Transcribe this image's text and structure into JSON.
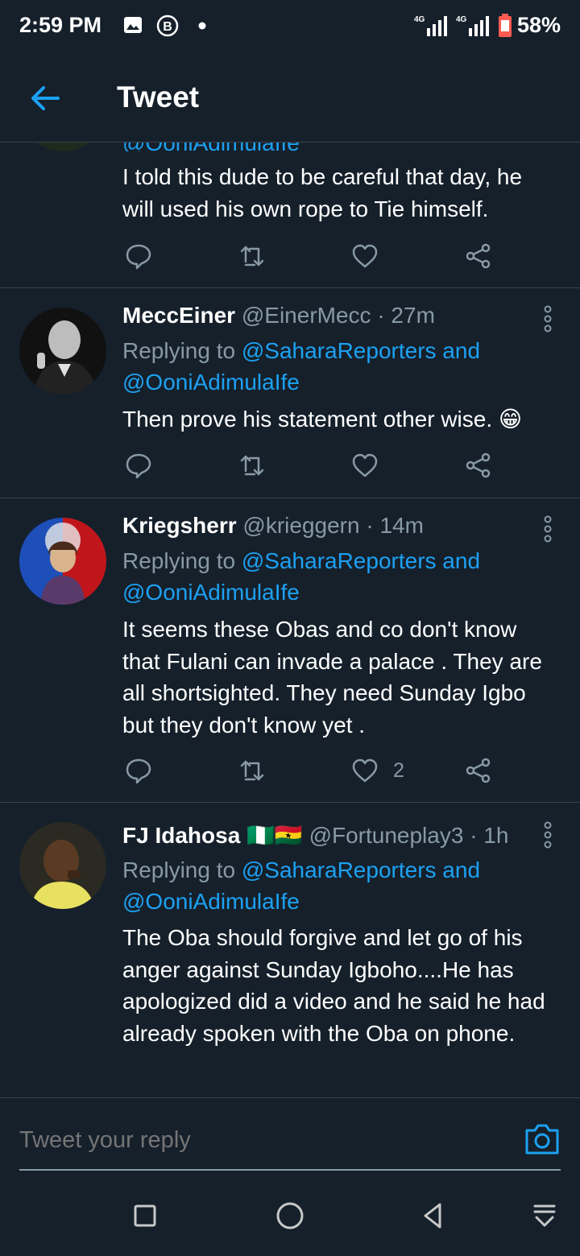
{
  "status_bar": {
    "time": "2:59 PM",
    "battery": "58%",
    "icons": [
      "image-icon",
      "b-icon",
      "dot-icon",
      "signal-4g-icon",
      "signal-4g-icon",
      "battery-icon"
    ]
  },
  "header": {
    "title": "Tweet",
    "back_icon": "arrow-left-icon"
  },
  "tweets": [
    {
      "reply_partial": "@OoniAdimulaIfe",
      "text": "I told this dude to be careful that day, he will  used his own rope to Tie himself."
    },
    {
      "name": "MeccEiner",
      "handle": "@EinerMecc",
      "time": "· 27m",
      "replying_prefix": "Replying to ",
      "reply_to_1": "@SaharaReporters and",
      "reply_to_2": "@OoniAdimulaIfe",
      "text": "Then prove his statement other wise. 😁"
    },
    {
      "name": "Kriegsherr",
      "handle": "@krieggern",
      "time": "· 14m",
      "replying_prefix": "Replying to ",
      "reply_to_1": "@SaharaReporters and",
      "reply_to_2": "@OoniAdimulaIfe",
      "text": "It seems these Obas and co don't know that Fulani can invade a palace . They are all shortsighted. They need Sunday Igbo but they don't know yet .",
      "likes": "2"
    },
    {
      "name": "FJ Idahosa",
      "flags": "🇳🇬🇬🇭",
      "handle": "@Fortuneplay3",
      "time": "· 1h",
      "replying_prefix": "Replying to ",
      "reply_to_1": "@SaharaReporters and",
      "reply_to_2": "@OoniAdimulaIfe",
      "text": "The Oba should forgive and let go of his anger against Sunday Igboho....He has apologized did a video and he said he had already spoken with the Oba on phone."
    }
  ],
  "reply_bar": {
    "placeholder": "Tweet your reply",
    "camera_icon": "camera-icon"
  },
  "colors": {
    "background": "#15202b",
    "accent": "#1da1f2",
    "muted": "#8899a6",
    "divider": "#38444d"
  }
}
